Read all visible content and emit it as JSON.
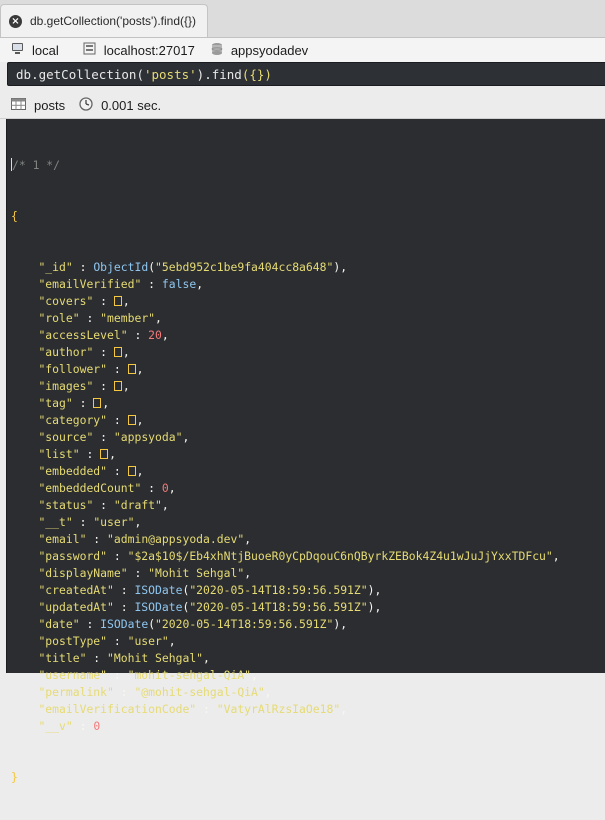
{
  "tab": {
    "title": "db.getCollection('posts').find({})"
  },
  "connection": {
    "server": "local",
    "host": "localhost:27017",
    "database": "appsyodadev"
  },
  "query": {
    "prefix": "db",
    "dot1": ".",
    "method1": "getCollection",
    "open1": "(",
    "arg": "'posts'",
    "close1": ")",
    "dot2": ".",
    "method2": "find",
    "args2": "({})"
  },
  "results": {
    "collection": "posts",
    "time": "0.001 sec."
  },
  "document": {
    "comment": "/* 1 */",
    "open_brace": "{",
    "close_brace": "}",
    "fields": [
      {
        "key": "\"_id\"",
        "type": "func",
        "func": "ObjectId",
        "arg": "\"5ebd952c1be9fa404cc8a648\""
      },
      {
        "key": "\"emailVerified\"",
        "type": "bool",
        "value": "false"
      },
      {
        "key": "\"covers\"",
        "type": "arr"
      },
      {
        "key": "\"role\"",
        "type": "str",
        "value": "\"member\""
      },
      {
        "key": "\"accessLevel\"",
        "type": "num",
        "value": "20"
      },
      {
        "key": "\"author\"",
        "type": "arr"
      },
      {
        "key": "\"follower\"",
        "type": "arr"
      },
      {
        "key": "\"images\"",
        "type": "arr"
      },
      {
        "key": "\"tag\"",
        "type": "arr"
      },
      {
        "key": "\"category\"",
        "type": "arr"
      },
      {
        "key": "\"source\"",
        "type": "str",
        "value": "\"appsyoda\""
      },
      {
        "key": "\"list\"",
        "type": "arr"
      },
      {
        "key": "\"embedded\"",
        "type": "arr"
      },
      {
        "key": "\"embeddedCount\"",
        "type": "num",
        "value": "0"
      },
      {
        "key": "\"status\"",
        "type": "str",
        "value": "\"draft\""
      },
      {
        "key": "\"__t\"",
        "type": "str",
        "value": "\"user\""
      },
      {
        "key": "\"email\"",
        "type": "str",
        "value": "\"admin@appsyoda.dev\""
      },
      {
        "key": "\"password\"",
        "type": "str",
        "value": "\"$2a$10$/Eb4xhNtjBuoeR0yCpDqouC6nQByrkZEBok4Z4u1wJuJjYxxTDFcu\""
      },
      {
        "key": "\"displayName\"",
        "type": "str",
        "value": "\"Mohit Sehgal\""
      },
      {
        "key": "\"createdAt\"",
        "type": "func",
        "func": "ISODate",
        "arg": "\"2020-05-14T18:59:56.591Z\""
      },
      {
        "key": "\"updatedAt\"",
        "type": "func",
        "func": "ISODate",
        "arg": "\"2020-05-14T18:59:56.591Z\""
      },
      {
        "key": "\"date\"",
        "type": "func",
        "func": "ISODate",
        "arg": "\"2020-05-14T18:59:56.591Z\""
      },
      {
        "key": "\"postType\"",
        "type": "str",
        "value": "\"user\""
      },
      {
        "key": "\"title\"",
        "type": "str",
        "value": "\"Mohit Sehgal\""
      },
      {
        "key": "\"username\"",
        "type": "str",
        "value": "\"mohit-sehgal-QiA\""
      },
      {
        "key": "\"permalink\"",
        "type": "str",
        "value": "\"@mohit-sehgal-QiA\""
      },
      {
        "key": "\"emailVerificationCode\"",
        "type": "str",
        "value": "\"VatyrAlRzsIaOe18\""
      },
      {
        "key": "\"__v\"",
        "type": "num",
        "value": "0"
      }
    ]
  },
  "icons": {
    "close": "close-icon",
    "server": "computer-icon",
    "host": "server-icon",
    "database": "database-icon",
    "collection": "table-icon",
    "time": "clock-icon"
  },
  "colors": {
    "editor_bg": "#2b2d30",
    "string": "#e6db74",
    "number": "#f27a7a",
    "keyword": "#8fc6f0",
    "brace": "#f5c842",
    "comment": "#7f8480"
  }
}
